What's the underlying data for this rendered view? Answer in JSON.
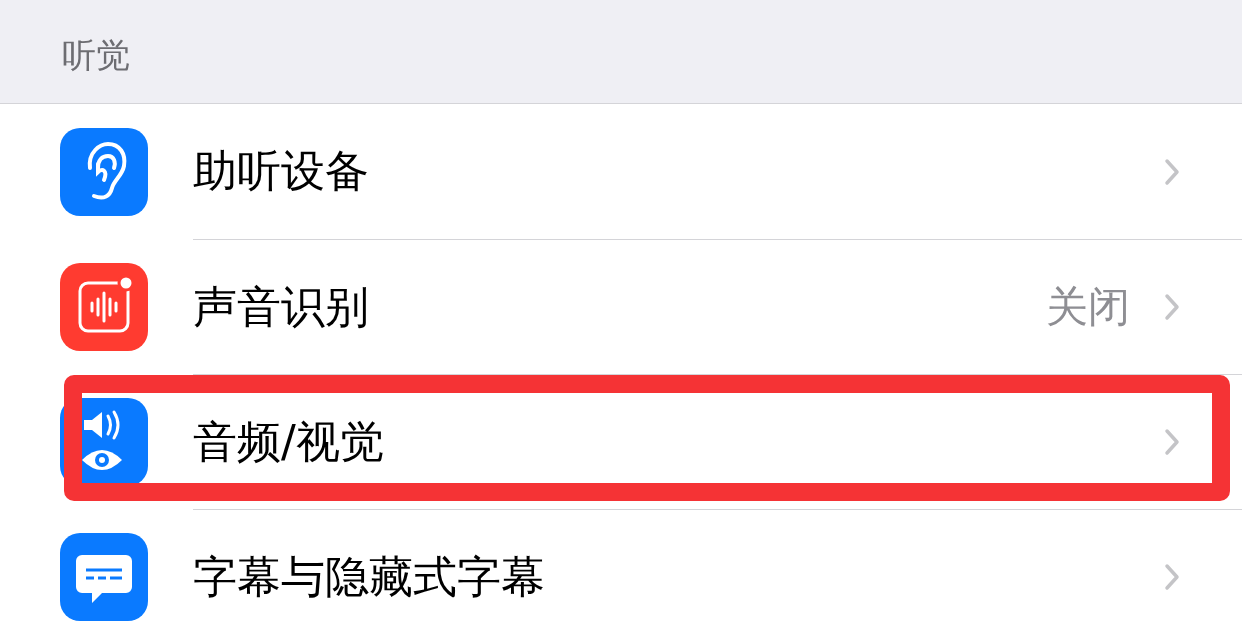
{
  "section": {
    "header": "听觉"
  },
  "rows": [
    {
      "label": "助听设备",
      "color": "#0a7aff",
      "highlighted": false
    },
    {
      "label": "声音识别",
      "value": "关闭",
      "color": "#ff3b30",
      "highlighted": false
    },
    {
      "label": "音频/视觉",
      "color": "#0a7aff",
      "highlighted": true
    },
    {
      "label": "字幕与隐藏式字幕",
      "color": "#0a7aff",
      "highlighted": false
    }
  ]
}
